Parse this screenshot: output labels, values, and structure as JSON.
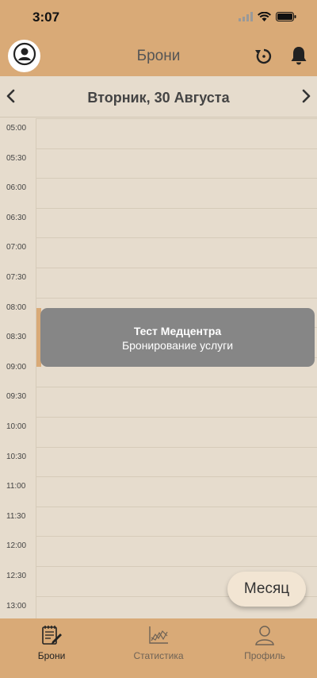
{
  "status": {
    "time": "3:07"
  },
  "header": {
    "title": "Брони"
  },
  "date_bar": {
    "title": "Вторник, 30 Августа"
  },
  "timeline": {
    "times": [
      "05:00",
      "05:30",
      "06:00",
      "06:30",
      "07:00",
      "07:30",
      "08:00",
      "08:30",
      "09:00",
      "09:30",
      "10:00",
      "10:30",
      "11:00",
      "11:30",
      "12:00",
      "12:30",
      "13:00"
    ]
  },
  "event": {
    "title": "Тест Медцентра",
    "subtitle": "Бронирование услуги",
    "start": "08:00",
    "end": "09:00"
  },
  "month_button": {
    "label": "Месяц"
  },
  "tabs": [
    {
      "label": "Брони",
      "icon": "notepad-icon",
      "active": true
    },
    {
      "label": "Статистика",
      "icon": "chart-icon",
      "active": false
    },
    {
      "label": "Профиль",
      "icon": "person-icon",
      "active": false
    }
  ],
  "colors": {
    "accent": "#d9aa77",
    "background": "#e6dccd",
    "event": "#868686"
  }
}
